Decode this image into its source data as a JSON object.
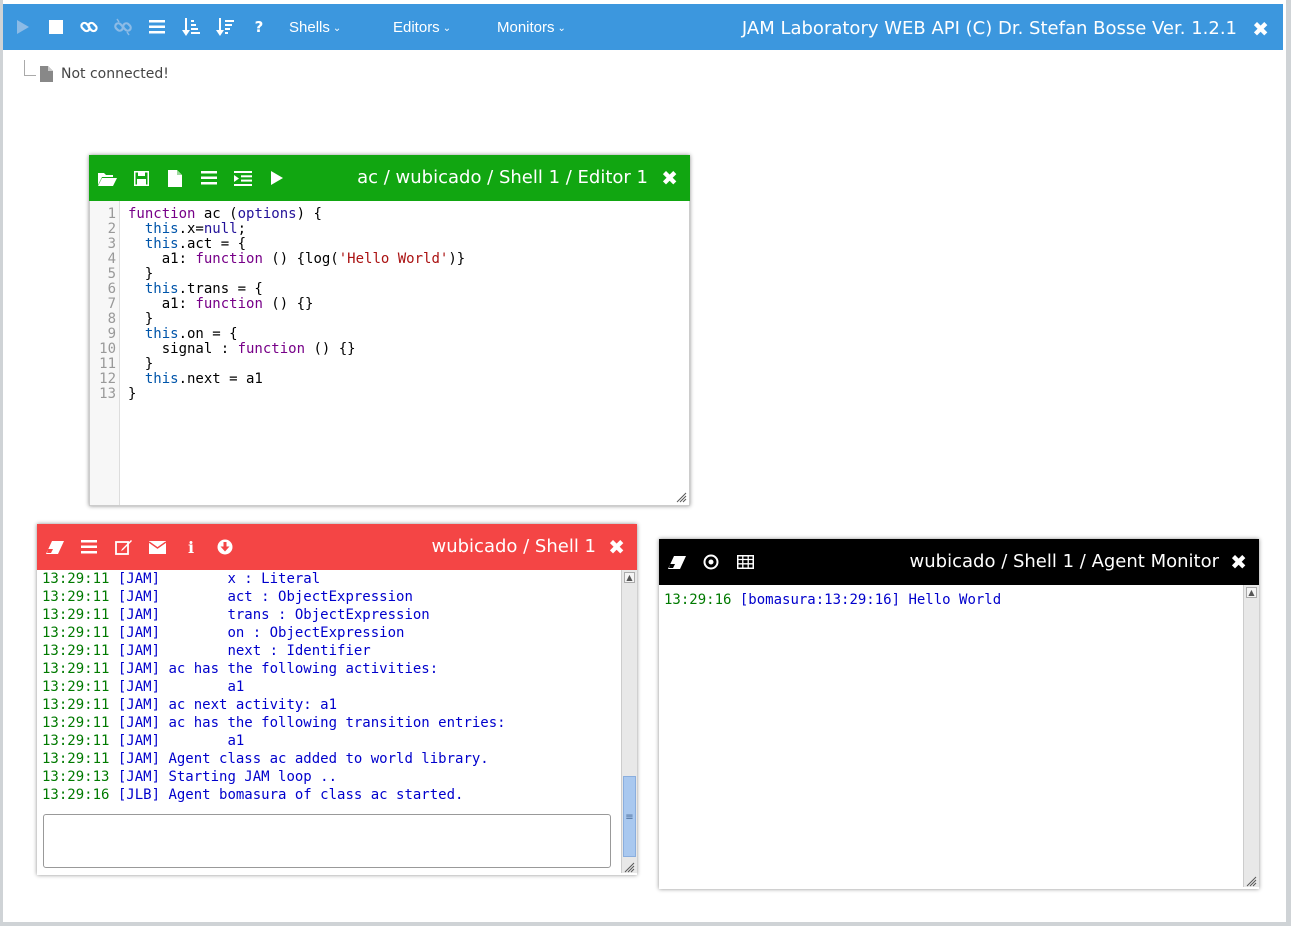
{
  "topbar": {
    "icons": [
      "play-icon",
      "stop-icon",
      "link-icon",
      "unlink-icon",
      "list-icon",
      "sort-asc-icon",
      "sort-desc-icon",
      "help-icon"
    ],
    "help_glyph": "?",
    "menus": [
      {
        "label": "Shells"
      },
      {
        "label": "Editors"
      },
      {
        "label": "Monitors"
      }
    ],
    "title": "JAM Laboratory WEB API (C) Dr. Stefan Bosse Ver. 1.2.1",
    "close_glyph": "✖"
  },
  "status": {
    "text": "Not connected!"
  },
  "editor": {
    "title": "ac / wubicado / Shell 1 / Editor 1",
    "close_glyph": "✖",
    "header_color": "#11a611",
    "toolbar_icons": [
      "folder-open-icon",
      "save-icon",
      "new-file-icon",
      "list-icon",
      "indent-icon",
      "run-icon"
    ],
    "line_numbers": [
      "1",
      "2",
      "3",
      "4",
      "5",
      "6",
      "7",
      "8",
      "9",
      "10",
      "11",
      "12",
      "13"
    ],
    "code_lines": [
      "function ac (options) {",
      "  this.x=null;",
      "  this.act = {",
      "    a1: function () {log('Hello World')}",
      "  }",
      "  this.trans = {",
      "    a1: function () {}",
      "  }",
      "  this.on = {",
      "    signal : function () {}",
      "  }",
      "  this.next = a1",
      "}"
    ]
  },
  "shell": {
    "title": "wubicado / Shell 1",
    "close_glyph": "✖",
    "header_color": "#f44545",
    "toolbar_icons": [
      "eraser-icon",
      "list-icon",
      "edit-icon",
      "envelope-icon",
      "info-icon",
      "download-icon"
    ],
    "info_glyph": "i",
    "lines": [
      {
        "time": "13:29:11",
        "msg": " [JAM]        x : Literal"
      },
      {
        "time": "13:29:11",
        "msg": " [JAM]        act : ObjectExpression"
      },
      {
        "time": "13:29:11",
        "msg": " [JAM]        trans : ObjectExpression"
      },
      {
        "time": "13:29:11",
        "msg": " [JAM]        on : ObjectExpression"
      },
      {
        "time": "13:29:11",
        "msg": " [JAM]        next : Identifier"
      },
      {
        "time": "13:29:11",
        "msg": " [JAM] ac has the following activities:"
      },
      {
        "time": "13:29:11",
        "msg": " [JAM]        a1"
      },
      {
        "time": "13:29:11",
        "msg": " [JAM] ac next activity: a1"
      },
      {
        "time": "13:29:11",
        "msg": " [JAM] ac has the following transition entries:"
      },
      {
        "time": "13:29:11",
        "msg": " [JAM]        a1"
      },
      {
        "time": "13:29:11",
        "msg": " [JAM] Agent class ac added to world library."
      },
      {
        "time": "13:29:13",
        "msg": " [JAM] Starting JAM loop .."
      },
      {
        "time": "13:29:16",
        "msg": " [JLB] Agent bomasura of class ac started."
      }
    ],
    "input_value": "",
    "scroll": {
      "up": "▲",
      "grip": "≡"
    }
  },
  "monitor": {
    "title": "wubicado / Shell 1 / Agent Monitor",
    "close_glyph": "✖",
    "header_color": "#000000",
    "toolbar_icons": [
      "eraser-icon",
      "target-icon",
      "table-icon"
    ],
    "lines": [
      {
        "time": "13:29:16",
        "msg": " [bomasura:13:29:16] Hello World"
      }
    ],
    "scroll": {
      "up": "▲"
    }
  }
}
